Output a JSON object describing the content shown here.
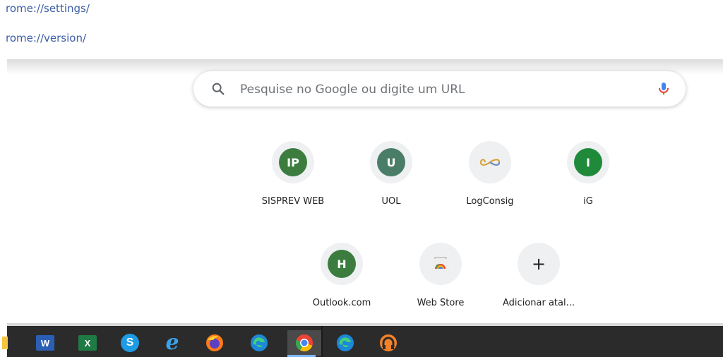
{
  "suggestions": [
    "rome://settings/",
    "rome://version/"
  ],
  "search": {
    "placeholder": "Pesquise no Google ou digite um URL",
    "search_icon": "magnifier-icon",
    "mic_icon": "microphone-icon"
  },
  "shortcuts": [
    {
      "label": "SISPREV WEB",
      "letter": "IP",
      "color": "#3c7d3f"
    },
    {
      "label": "UOL",
      "letter": "U",
      "color": "#4a7d68"
    },
    {
      "label": "LogConsig",
      "icon": "infinity-logo-icon"
    },
    {
      "label": "iG",
      "letter": "I",
      "color": "#1f8a3a"
    },
    {
      "label": "Outlook.com",
      "letter": "H",
      "color": "#3c7d3f"
    },
    {
      "label": "Web Store",
      "icon": "chrome-web-store-icon"
    },
    {
      "label": "Adicionar atal...",
      "symbol": "+"
    }
  ],
  "taskbar": {
    "items": [
      {
        "name": "file-explorer-icon"
      },
      {
        "name": "word-icon",
        "glyph": "W"
      },
      {
        "name": "excel-icon",
        "glyph": "X"
      },
      {
        "name": "skype-icon",
        "glyph": "S"
      },
      {
        "name": "internet-explorer-icon",
        "glyph": "e"
      },
      {
        "name": "firefox-icon"
      },
      {
        "name": "edge-icon"
      },
      {
        "name": "chrome-icon",
        "active": true
      },
      {
        "name": "edge-icon-2"
      },
      {
        "name": "radio-app-icon"
      }
    ]
  }
}
